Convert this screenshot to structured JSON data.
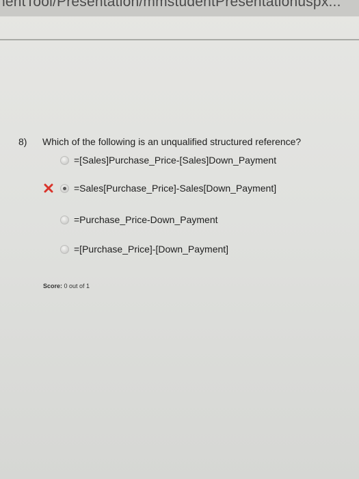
{
  "browser": {
    "url_fragment": "nentTool/Presentation/mmstudentPresentationuspx..."
  },
  "question": {
    "number": "8)",
    "text": "Which of the following is an unqualified structured reference?",
    "options": [
      {
        "label": "=[Sales]Purchase_Price-[Sales]Down_Payment",
        "selected": false,
        "marked_wrong": false
      },
      {
        "label": "=Sales[Purchase_Price]-Sales[Down_Payment]",
        "selected": true,
        "marked_wrong": true
      },
      {
        "label": "=Purchase_Price-Down_Payment",
        "selected": false,
        "marked_wrong": false
      },
      {
        "label": "=[Purchase_Price]-[Down_Payment]",
        "selected": false,
        "marked_wrong": false
      }
    ]
  },
  "score": {
    "label": "Score:",
    "value": "0 out of 1"
  },
  "colors": {
    "wrong_mark": "#d9342b",
    "background": "#e3e3e0"
  },
  "icons": {
    "wrong": "x-mark-icon",
    "radio": "radio-button-icon"
  }
}
